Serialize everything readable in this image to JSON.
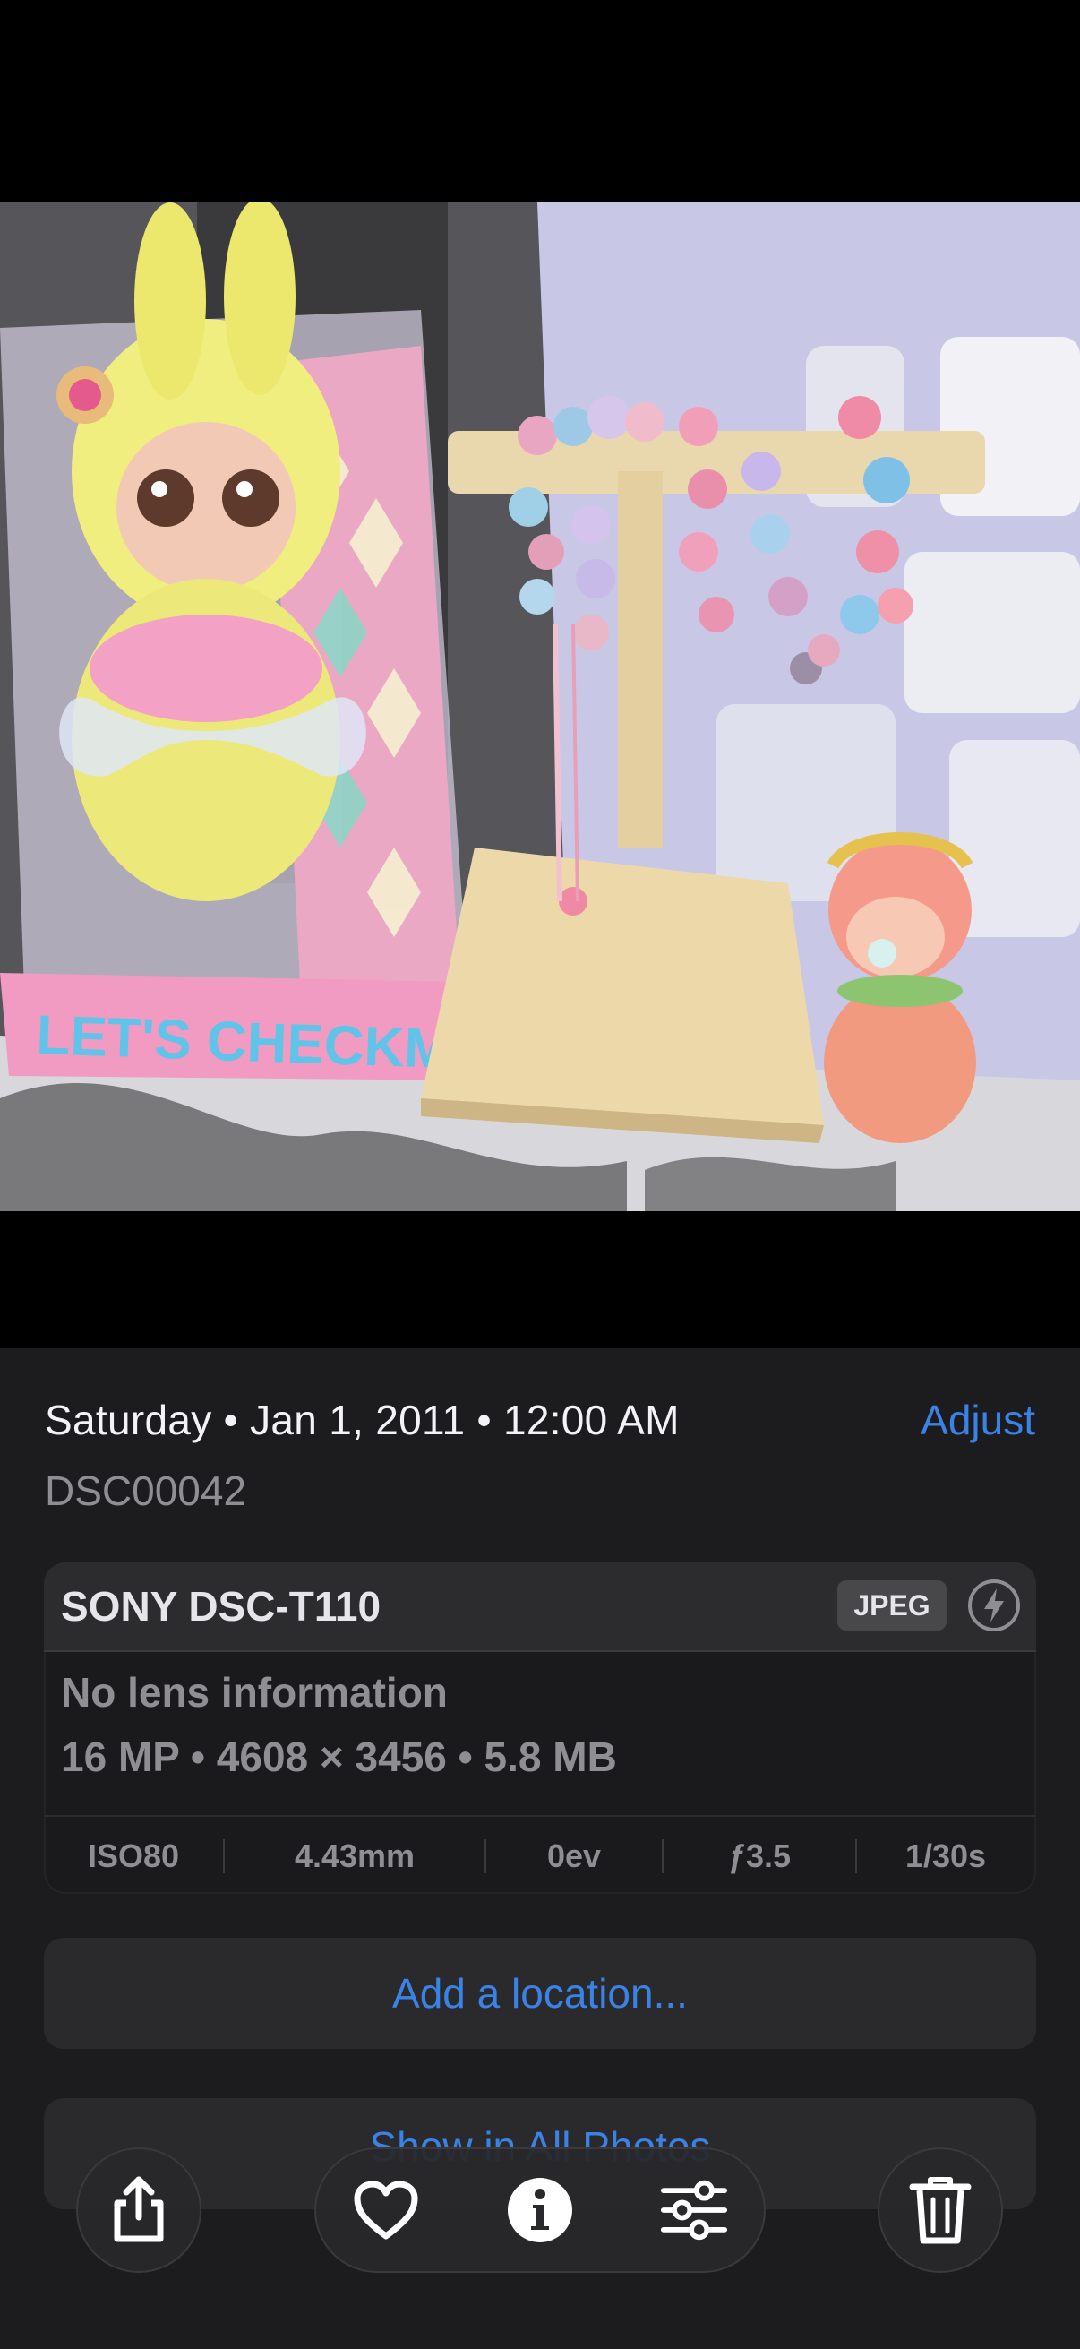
{
  "header": {
    "date_line": "Saturday • Jan 1, 2011 • 12:00 AM",
    "adjust_label": "Adjust",
    "filename": "DSC00042"
  },
  "camera_card": {
    "model": "SONY DSC-T110",
    "format_badge": "JPEG",
    "lens": "No lens information",
    "specs": "16 MP • 4608 × 3456 • 5.8 MB",
    "exif": [
      "ISO80",
      "4.43mm",
      "0ev",
      "ƒ3.5",
      "1/30s"
    ]
  },
  "actions": {
    "add_location": "Add a location...",
    "show_in_all_photos": "Show in All Photos"
  },
  "photo": {
    "box_text": "LET'S CHECKMATE"
  },
  "toolbar": {
    "icons": [
      "share-icon",
      "heart-icon",
      "info-icon",
      "sliders-icon",
      "trash-icon"
    ]
  },
  "colors": {
    "accent": "#3b82e6",
    "sheet_bg": "#1c1c1e"
  }
}
